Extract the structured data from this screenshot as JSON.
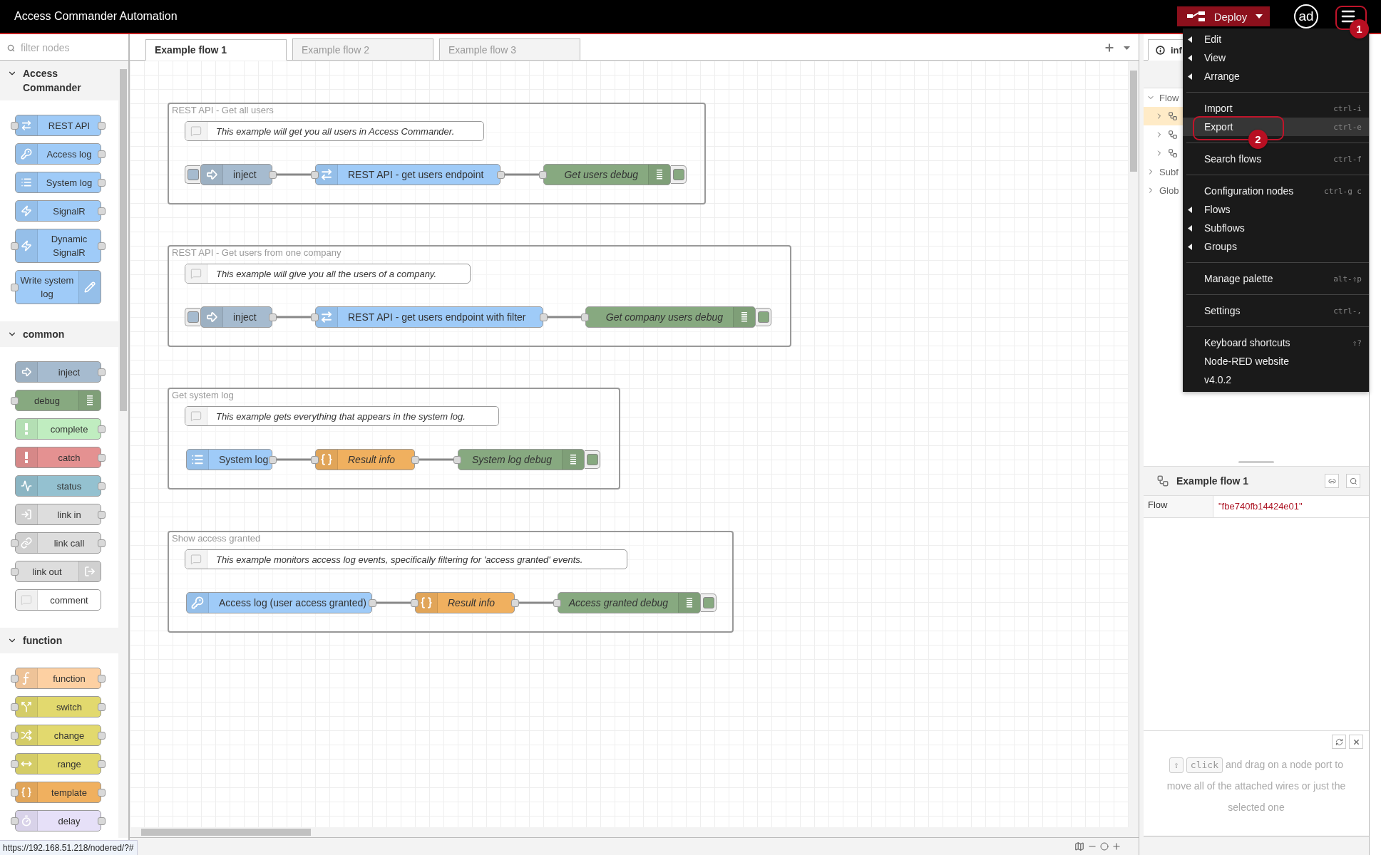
{
  "header": {
    "title": "Access Commander Automation",
    "deploy": {
      "label": "Deploy"
    },
    "user": {
      "initials": "ad"
    }
  },
  "menu": {
    "groups": [
      [
        {
          "label": "Edit",
          "submenu": true,
          "highlighted": false
        },
        {
          "label": "View",
          "submenu": true,
          "highlighted": false
        },
        {
          "label": "Arrange",
          "submenu": true,
          "highlighted": false
        }
      ],
      [
        {
          "label": "Import",
          "shortcut": "ctrl-i",
          "submenu": false,
          "highlighted": false
        },
        {
          "label": "Export",
          "shortcut": "ctrl-e",
          "submenu": false,
          "highlighted": true
        }
      ],
      [
        {
          "label": "Search flows",
          "shortcut": "ctrl-f",
          "submenu": false,
          "highlighted": false
        }
      ],
      [
        {
          "label": "Configuration nodes",
          "shortcut": "ctrl-g c",
          "submenu": false,
          "highlighted": false
        },
        {
          "label": "Flows",
          "submenu": true,
          "highlighted": false
        },
        {
          "label": "Subflows",
          "submenu": true,
          "highlighted": false
        },
        {
          "label": "Groups",
          "submenu": true,
          "highlighted": false
        }
      ],
      [
        {
          "label": "Manage palette",
          "shortcut": "alt-⇧p",
          "submenu": false,
          "highlighted": false
        }
      ],
      [
        {
          "label": "Settings",
          "shortcut": "ctrl-,",
          "submenu": false,
          "highlighted": false
        }
      ],
      [
        {
          "label": "Keyboard shortcuts",
          "shortcut": "⇧?",
          "submenu": false,
          "highlighted": false
        },
        {
          "label": "Node-RED website",
          "submenu": false,
          "highlighted": false
        },
        {
          "label": "v4.0.2",
          "submenu": false,
          "highlighted": false
        }
      ]
    ]
  },
  "annotations": [
    {
      "label": "1"
    },
    {
      "label": "2"
    }
  ],
  "palette": {
    "filter": {
      "placeholder": "filter nodes"
    },
    "categories": [
      {
        "title": "Access Commander",
        "expanded": true,
        "nodes": [
          {
            "label": "REST API",
            "kind": "rest",
            "color": "#9fcbf8"
          },
          {
            "label": "Access log",
            "kind": "key",
            "color": "#9fcbf8"
          },
          {
            "label": "System log",
            "kind": "list",
            "color": "#9fcbf8"
          },
          {
            "label": "SignalR",
            "kind": "bolt",
            "color": "#9fcbf8"
          },
          {
            "label": "Dynamic SignalR",
            "kind": "dynbolt",
            "color": "#9fcbf8"
          },
          {
            "label": "Write system log",
            "kind": "pencil",
            "color": "#9fcbf8"
          }
        ]
      },
      {
        "title": "common",
        "expanded": true,
        "nodes": [
          {
            "label": "inject",
            "kind": "inject",
            "color": "#a6bbcf"
          },
          {
            "label": "debug",
            "kind": "debug",
            "color": "#87a980"
          },
          {
            "label": "complete",
            "kind": "complete",
            "color": "#c0edc0"
          },
          {
            "label": "catch",
            "kind": "catch",
            "color": "#e49191"
          },
          {
            "label": "status",
            "kind": "status",
            "color": "#94c1d0"
          },
          {
            "label": "link in",
            "kind": "linkin",
            "color": "#dddddd"
          },
          {
            "label": "link call",
            "kind": "linkcall",
            "color": "#dddddd"
          },
          {
            "label": "link out",
            "kind": "linkout",
            "color": "#dddddd"
          },
          {
            "label": "comment",
            "kind": "comment",
            "color": "#ffffff"
          }
        ]
      },
      {
        "title": "function",
        "expanded": true,
        "nodes": [
          {
            "label": "function",
            "kind": "function",
            "color": "#fdd0a2"
          },
          {
            "label": "switch",
            "kind": "switch",
            "color": "#e2d96e"
          },
          {
            "label": "change",
            "kind": "change",
            "color": "#e2d96e"
          },
          {
            "label": "range",
            "kind": "range",
            "color": "#e2d96e"
          },
          {
            "label": "template",
            "kind": "template",
            "color": "#f0b05f"
          },
          {
            "label": "delay",
            "kind": "delay",
            "color": "#e6e0f8"
          }
        ]
      }
    ]
  },
  "workspace": {
    "tabs": [
      {
        "label": "Example flow 1",
        "selected": true
      },
      {
        "label": "Example flow 2",
        "selected": false
      },
      {
        "label": "Example flow 3",
        "selected": false
      }
    ],
    "groups": [
      {
        "title": "REST API - Get all users",
        "comment": "This example will get you all users in Access Commander.",
        "nodes": [
          {
            "label": "inject",
            "kind": "inject",
            "color": "#a6bbcf"
          },
          {
            "label": "REST API - get users endpoint",
            "kind": "rest",
            "color": "#9fcbf8"
          },
          {
            "label": "Get users debug",
            "kind": "debug",
            "color": "#87a980"
          }
        ]
      },
      {
        "title": "REST API - Get users from one company",
        "comment": "This example will give you all the users of a company.",
        "nodes": [
          {
            "label": "inject",
            "kind": "inject",
            "color": "#a6bbcf"
          },
          {
            "label": "REST API - get users endpoint with filter",
            "kind": "rest",
            "color": "#9fcbf8"
          },
          {
            "label": "Get company users debug",
            "kind": "debug",
            "color": "#87a980"
          }
        ]
      },
      {
        "title": "Get system log",
        "comment": "This example gets everything that appears in the system log.",
        "nodes": [
          {
            "label": "System log",
            "kind": "list",
            "color": "#9fcbf8"
          },
          {
            "label": "Result info",
            "kind": "template",
            "color": "#f0b05f"
          },
          {
            "label": "System log debug",
            "kind": "debug",
            "color": "#87a980"
          }
        ]
      },
      {
        "title": "Show access granted",
        "comment": "This example monitors access log events, specifically filtering for 'access granted' events.",
        "nodes": [
          {
            "label": "Access log (user access granted)",
            "kind": "key",
            "color": "#9fcbf8"
          },
          {
            "label": "Result info",
            "kind": "template",
            "color": "#f0b05f"
          },
          {
            "label": "Access granted debug",
            "kind": "debug",
            "color": "#87a980"
          }
        ]
      }
    ]
  },
  "sidebar": {
    "tab": "inf",
    "tree": [
      {
        "label": "Flow",
        "expanded": true,
        "children": [
          {
            "selected": true,
            "expanded": false
          },
          {
            "selected": false,
            "expanded": false
          },
          {
            "selected": false,
            "expanded": false
          }
        ]
      },
      {
        "label": "Subf",
        "expanded": false
      },
      {
        "label": "Glob",
        "expanded": false
      }
    ],
    "info": {
      "title": "Example flow 1",
      "rows": [
        {
          "key": "Flow",
          "value": "\"fbe740fb14424e01\""
        }
      ]
    },
    "tip": {
      "keys": [
        "⇧",
        "click"
      ],
      "text": "and drag on a node port to move all of the attached wires or just the selected one"
    }
  },
  "status_url": "https://192.168.51.218/nodered/?#"
}
